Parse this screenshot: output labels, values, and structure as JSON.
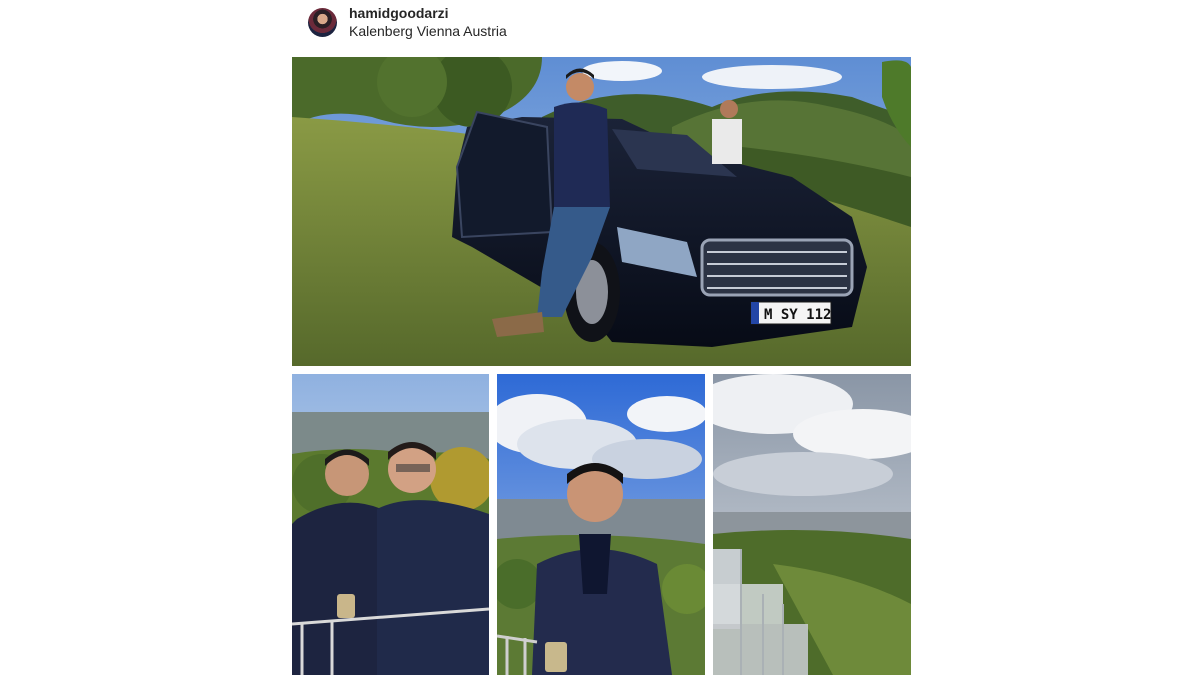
{
  "post": {
    "username": "hamidgoodarzi",
    "location": "Kalenberg Vienna Austria"
  },
  "photos": {
    "main": {
      "plate": "M SY 112"
    }
  },
  "colors": {
    "text": "#262626",
    "sky": "#6f9fd8",
    "grass": "#6d7f34",
    "car": "#0d1426"
  }
}
